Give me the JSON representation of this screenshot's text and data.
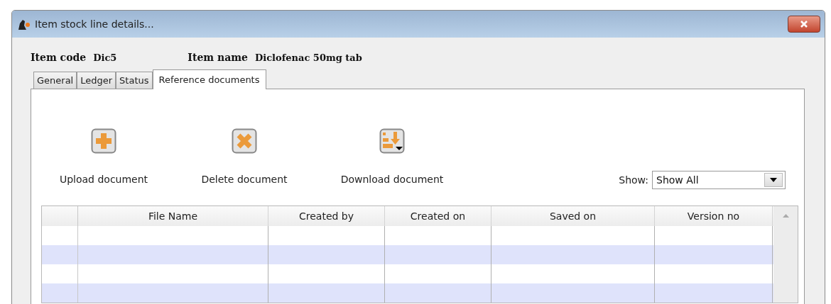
{
  "window": {
    "title": "Item stock line details..."
  },
  "header": {
    "item_code_label": "Item code",
    "item_code": "Dic5",
    "item_name_label": "Item name",
    "item_name": "Diclofenac 50mg tab"
  },
  "tabs": [
    {
      "label": "General",
      "selected": false
    },
    {
      "label": "Ledger",
      "selected": false
    },
    {
      "label": "Status",
      "selected": false
    },
    {
      "label": "Reference documents",
      "selected": true
    }
  ],
  "toolbar": [
    {
      "kind": "upload",
      "label": "Upload document"
    },
    {
      "kind": "delete",
      "label": "Delete document"
    },
    {
      "kind": "download",
      "label": "Download document"
    }
  ],
  "show_filter": {
    "label": "Show:",
    "value": "Show All"
  },
  "table": {
    "columns": [
      "File Name",
      "Created by",
      "Created on",
      "Saved on",
      "Version no"
    ]
  }
}
